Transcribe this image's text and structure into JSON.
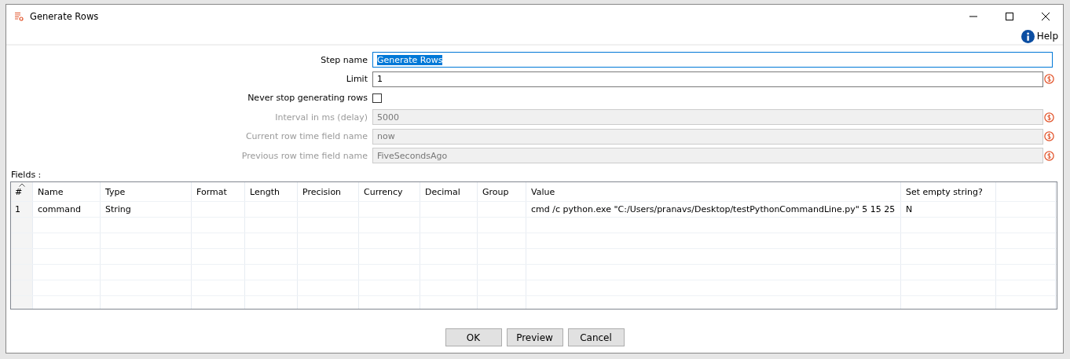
{
  "window": {
    "title": "Generate Rows"
  },
  "help": {
    "label": "Help"
  },
  "form": [
    {
      "label": "Step name",
      "kind": "text",
      "value": "Generate Rows",
      "focused": true,
      "disabled": false,
      "variable": false
    },
    {
      "label": "Limit",
      "kind": "text",
      "value": "1",
      "focused": false,
      "disabled": false,
      "variable": true
    },
    {
      "label": "Never stop generating rows",
      "kind": "checkbox",
      "checked": false
    },
    {
      "label": "Interval in ms (delay)",
      "kind": "text",
      "value": "5000",
      "focused": false,
      "disabled": true,
      "variable": true
    },
    {
      "label": "Current row time field name",
      "kind": "text",
      "value": "now",
      "focused": false,
      "disabled": true,
      "variable": true
    },
    {
      "label": "Previous row time field name",
      "kind": "text",
      "value": "FiveSecondsAgo",
      "focused": false,
      "disabled": true,
      "variable": true
    }
  ],
  "fields": {
    "label": "Fields :",
    "columns": [
      "#",
      "Name",
      "Type",
      "Format",
      "Length",
      "Precision",
      "Currency",
      "Decimal",
      "Group",
      "Value",
      "Set empty string?",
      null
    ],
    "rows": [
      {
        "cells": [
          "1",
          "command",
          "String",
          null,
          null,
          null,
          null,
          null,
          null,
          "cmd /c python.exe \"C:/Users/pranavs/Desktop/testPythonCommandLine.py\" 5 15 25",
          "N",
          null
        ]
      }
    ]
  },
  "buttons": [
    "OK",
    "Preview",
    "Cancel"
  ]
}
